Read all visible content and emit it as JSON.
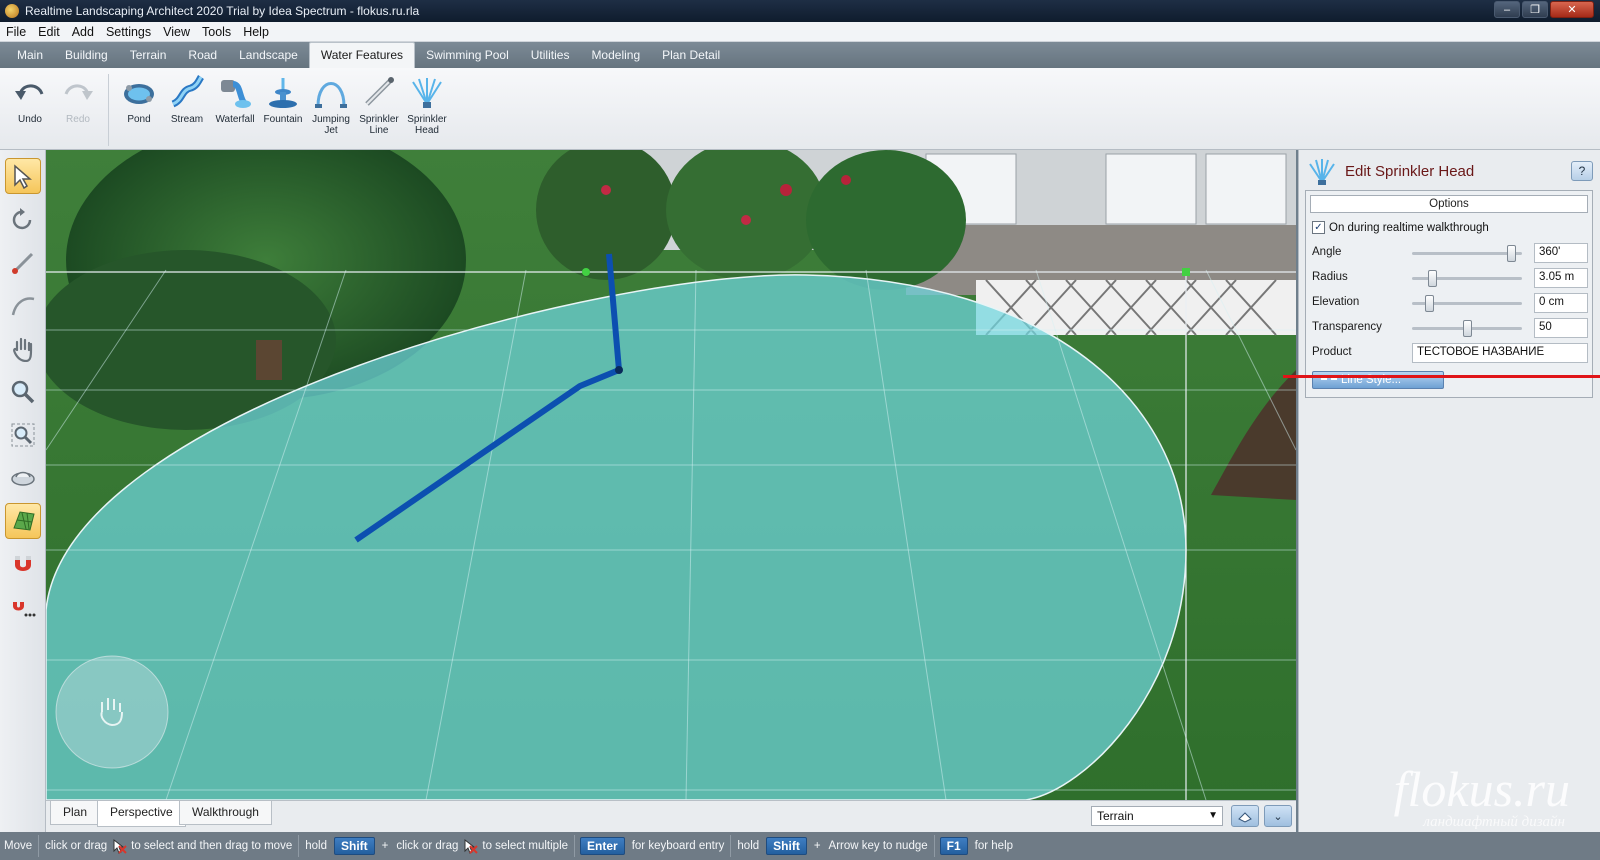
{
  "window": {
    "title": "Realtime Landscaping Architect 2020 Trial by Idea Spectrum - flokus.ru.rla",
    "buttons": [
      "–",
      "❐",
      "✕"
    ]
  },
  "menu": [
    "File",
    "Edit",
    "Add",
    "Settings",
    "View",
    "Tools",
    "Help"
  ],
  "tabs": [
    {
      "label": "Main",
      "active": false
    },
    {
      "label": "Building",
      "active": false
    },
    {
      "label": "Terrain",
      "active": false
    },
    {
      "label": "Road",
      "active": false
    },
    {
      "label": "Landscape",
      "active": false
    },
    {
      "label": "Water Features",
      "active": true
    },
    {
      "label": "Swimming Pool",
      "active": false
    },
    {
      "label": "Utilities",
      "active": false
    },
    {
      "label": "Modeling",
      "active": false
    },
    {
      "label": "Plan Detail",
      "active": false
    }
  ],
  "ribbon": {
    "history": [
      {
        "label": "Undo",
        "icon": "undo-icon",
        "enabled": true
      },
      {
        "label": "Redo",
        "icon": "redo-icon",
        "enabled": false
      }
    ],
    "tools": [
      {
        "label": "Pond",
        "icon": "pond-icon"
      },
      {
        "label": "Stream",
        "icon": "stream-icon"
      },
      {
        "label": "Waterfall",
        "icon": "waterfall-icon"
      },
      {
        "label": "Fountain",
        "icon": "fountain-icon"
      },
      {
        "label": "Jumping\nJet",
        "icon": "jumping-jet-icon"
      },
      {
        "label": "Sprinkler\nLine",
        "icon": "sprinkler-line-icon"
      },
      {
        "label": "Sprinkler\nHead",
        "icon": "sprinkler-head-icon"
      }
    ]
  },
  "left_tools": [
    {
      "icon": "select-arrow-icon",
      "active": true
    },
    {
      "icon": "rotate-icon",
      "active": false
    },
    {
      "icon": "measure-icon",
      "active": false
    },
    {
      "icon": "arc-icon",
      "active": false
    },
    {
      "icon": "pan-hand-icon",
      "active": false
    },
    {
      "icon": "zoom-icon",
      "active": false
    },
    {
      "icon": "zoom-region-icon",
      "active": false
    },
    {
      "icon": "orbit-icon",
      "active": false
    },
    {
      "icon": "grid-icon",
      "active": true
    },
    {
      "icon": "snap-magnet-icon",
      "active": false
    },
    {
      "icon": "snap-options-icon",
      "active": false
    }
  ],
  "view": {
    "tabs": [
      {
        "label": "Plan",
        "active": false
      },
      {
        "label": "Perspective",
        "active": true
      },
      {
        "label": "Walkthrough",
        "active": false
      }
    ],
    "layer_select": "Terrain"
  },
  "panel": {
    "title": "Edit Sprinkler Head",
    "help": "?",
    "section": "Options",
    "walkthrough_label": "On during realtime walkthrough",
    "walkthrough_checked": true,
    "properties": [
      {
        "label": "Angle",
        "value": "360'",
        "level": 0.9
      },
      {
        "label": "Radius",
        "value": "3.05 m",
        "level": 0.18
      },
      {
        "label": "Elevation",
        "value": "0 cm",
        "level": 0.15
      },
      {
        "label": "Transparency",
        "value": "50",
        "level": 0.5
      }
    ],
    "product_label": "Product",
    "product_value": "ТЕСТОВОЕ НАЗВАНИЕ",
    "line_style": "Line Style..."
  },
  "watermark": {
    "logo": "flokus.ru",
    "subtitle": "ландшафтный дизайн"
  },
  "status": {
    "mode": "Move",
    "t1": "click or drag",
    "t2": "to select and then drag to move",
    "hold1": "hold",
    "shift1": "Shift",
    "plus1": "+",
    "t3": "click or drag",
    "t4": "to select multiple",
    "enter": "Enter",
    "t5": "for keyboard entry",
    "hold2": "hold",
    "shift2": "Shift",
    "plus2": "+",
    "t6": "Arrow key to nudge",
    "f1": "F1",
    "t7": "for help"
  },
  "colors": {
    "accent_red": "#e01418",
    "sprinkler_blue": "#0c4fb0",
    "water_overlay": "#6fd6de"
  }
}
